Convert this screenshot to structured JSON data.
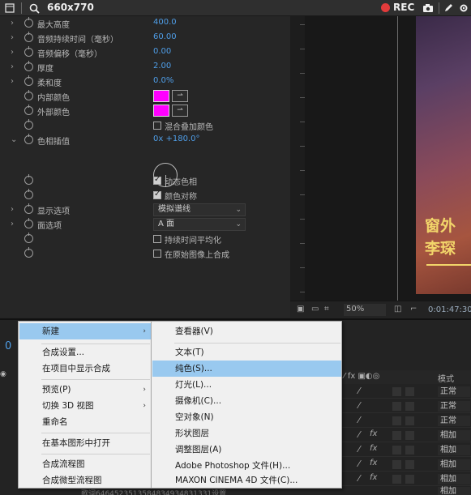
{
  "topbar": {
    "title": "660x770",
    "rec_label": "REC",
    "icons": [
      "square-icon",
      "search-icon",
      "camera-icon",
      "pen-icon",
      "settings-icon"
    ]
  },
  "effect_controls": {
    "rows": [
      {
        "label": "最大高度",
        "value": "400.0",
        "has_arrow": true
      },
      {
        "label": "音频持续时间（毫秒）",
        "value": "60.00",
        "has_arrow": true
      },
      {
        "label": "音频偏移（毫秒）",
        "value": "0.00",
        "has_arrow": true
      },
      {
        "label": "厚度",
        "value": "2.00",
        "has_arrow": true
      },
      {
        "label": "柔和度",
        "value": "0.0%",
        "has_arrow": true
      },
      {
        "label": "内部颜色",
        "swatch": "#ff00ff"
      },
      {
        "label": "外部颜色",
        "swatch": "#ff00ff"
      }
    ],
    "blend_checkbox_label": "混合叠加颜色",
    "hue_interp_label": "色相插值",
    "hue_interp_value": "0x +180.0°",
    "dynamic_hue_label": "动态色相",
    "color_symmetry_label": "颜色对称",
    "display_options_label": "显示选项",
    "display_options_value": "模拟谱线",
    "side_options_label": "面选项",
    "side_options_value": "A 面",
    "avg_duration_label": "持续时间平均化",
    "composite_on_original_label": "在原始图像上合成"
  },
  "viewer": {
    "comp_title_line1": "窗外",
    "comp_title_line2": "李琛",
    "zoom": "50%",
    "timecode": "0:01:47:30"
  },
  "timeline": {
    "frame_display": "0",
    "mode_header": "模式",
    "modes": [
      "正常",
      "正常",
      "正常",
      "相加",
      "相加",
      "相加",
      "相加",
      "相加"
    ],
    "bottom_text": "歌词6464523513584834934831331设置"
  },
  "main_menu": {
    "items": [
      {
        "label": "新建",
        "has_sub": true,
        "highlight": true
      },
      {
        "label": "合成设置..."
      },
      {
        "label": "在项目中显示合成"
      },
      {
        "label": "预览(P)",
        "has_sub": true
      },
      {
        "label": "切换 3D 视图",
        "has_sub": true
      },
      {
        "label": "重命名"
      },
      {
        "label": "在基本图形中打开"
      },
      {
        "label": "合成流程图"
      },
      {
        "label": "合成微型流程图"
      }
    ]
  },
  "sub_menu": {
    "items": [
      {
        "label": "查看器(V)"
      },
      {
        "label": "文本(T)"
      },
      {
        "label": "纯色(S)...",
        "highlight": true
      },
      {
        "label": "灯光(L)..."
      },
      {
        "label": "摄像机(C)..."
      },
      {
        "label": "空对象(N)"
      },
      {
        "label": "形状图层"
      },
      {
        "label": "调整图层(A)"
      },
      {
        "label": "Adobe Photoshop 文件(H)..."
      },
      {
        "label": "MAXON CINEMA 4D 文件(C)..."
      }
    ]
  }
}
